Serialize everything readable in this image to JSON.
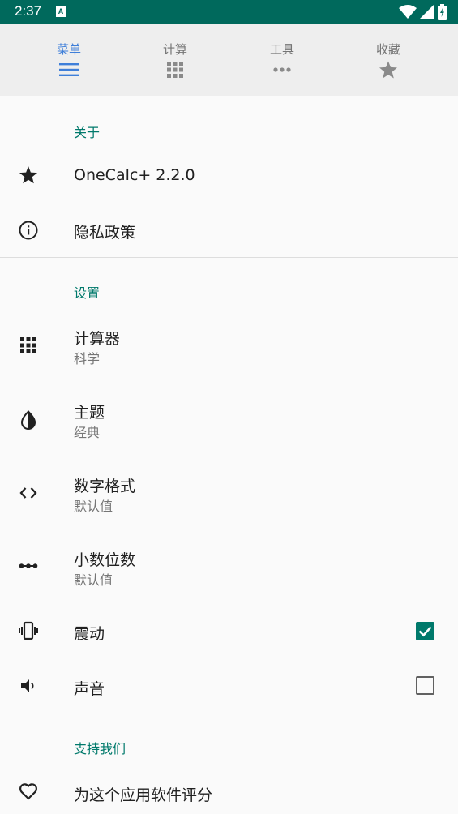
{
  "status_bar": {
    "time": "2:37",
    "notif_letter": "A"
  },
  "tabs": [
    {
      "label": "菜单",
      "icon": "menu-icon",
      "active": true
    },
    {
      "label": "计算",
      "icon": "grid-icon",
      "active": false
    },
    {
      "label": "工具",
      "icon": "more-horiz-icon",
      "active": false
    },
    {
      "label": "收藏",
      "icon": "star-icon",
      "active": false
    }
  ],
  "sections": {
    "about": "关于",
    "settings": "设置",
    "support": "支持我们"
  },
  "items": {
    "version": {
      "title": "OneCalc+ 2.2.0",
      "icon": "star-icon"
    },
    "privacy": {
      "title": "隐私政策",
      "icon": "info-icon"
    },
    "calculator": {
      "title": "计算器",
      "subtitle": "科学",
      "icon": "grid-icon"
    },
    "theme": {
      "title": "主题",
      "subtitle": "经典",
      "icon": "contrast-icon"
    },
    "number_format": {
      "title": "数字格式",
      "subtitle": "默认值",
      "icon": "code-icon"
    },
    "decimals": {
      "title": "小数位数",
      "subtitle": "默认值",
      "icon": "decimal-icon"
    },
    "vibration": {
      "title": "震动",
      "icon": "vibration-icon",
      "checked": true
    },
    "sound": {
      "title": "声音",
      "icon": "volume-icon",
      "checked": false
    },
    "rate": {
      "title": "为这个应用软件评分",
      "icon": "heart-icon"
    }
  },
  "colors": {
    "accent": "#00796b",
    "status_bar": "#00695c",
    "active_tab": "#3f7fd9"
  }
}
